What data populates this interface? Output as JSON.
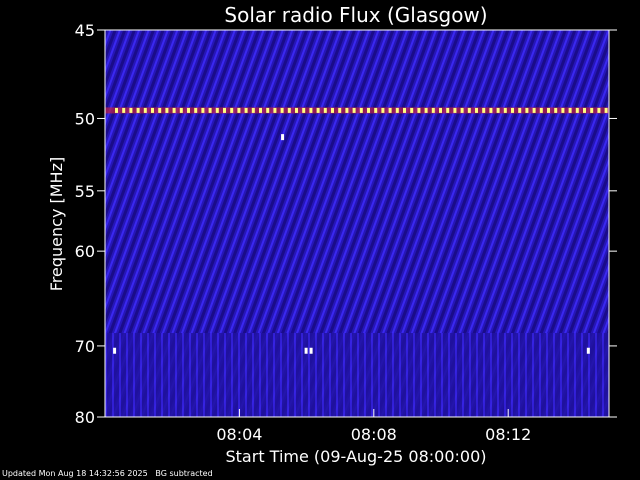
{
  "chart_data": {
    "type": "heatmap",
    "title": "Solar radio Flux (Glasgow)",
    "xlabel": "Start Time (09-Aug-25 08:00:00)",
    "ylabel": "Frequency [MHz]",
    "x_ticks": [
      "08:04",
      "08:08",
      "08:12"
    ],
    "x_tick_minutes": [
      4,
      8,
      12
    ],
    "xlim_minutes": [
      0,
      15
    ],
    "y_ticks": [
      45,
      50,
      55,
      60,
      70,
      80
    ],
    "ylim": [
      45,
      80
    ],
    "y_scale": "reciprocal",
    "colormap": [
      "#1a0a8c",
      "#2a1ad0",
      "#3a2aff",
      "#c02040",
      "#ffff80"
    ],
    "features": [
      {
        "name": "interference line",
        "frequency_mhz": 49.5
      },
      {
        "name": "burst dot",
        "time_minutes": 5.3,
        "frequency_mhz": 51.2
      },
      {
        "name": "burst dots",
        "time_minutes": 0.3,
        "frequency_mhz": 70.6
      },
      {
        "name": "burst dots",
        "time_minutes": 6.0,
        "frequency_mhz": 70.6
      },
      {
        "name": "burst dots",
        "time_minutes": 14.4,
        "frequency_mhz": 70.6
      }
    ],
    "grid": false
  },
  "footer": {
    "updated": "Updated Mon Aug 18 14:32:56 2025",
    "note": "BG subtracted"
  }
}
